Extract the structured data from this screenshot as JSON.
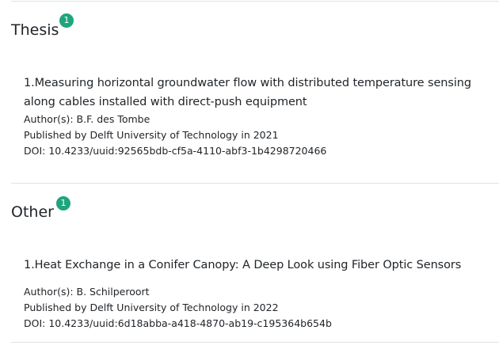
{
  "colors": {
    "badge": "#1fa57e",
    "divider": "#dee2e6",
    "text": "#212529"
  },
  "sections": [
    {
      "title": "Thesis",
      "count": "1",
      "items": [
        {
          "title": "1.Measuring horizontal groundwater flow with distributed temperature sensing along cables installed with direct-push equipment",
          "authors": "Author(s): B.F. des Tombe",
          "published": "Published by Delft University of Technology in 2021",
          "doi": "DOI: 10.4233/uuid:92565bdb-cf5a-4110-abf3-1b4298720466"
        }
      ]
    },
    {
      "title": "Other",
      "count": "1",
      "items": [
        {
          "title": "1.Heat Exchange in a Conifer Canopy: A Deep Look using Fiber Optic Sensors",
          "authors": "Author(s): B. Schilperoort",
          "published": "Published by Delft University of Technology in 2022",
          "doi": "DOI: 10.4233/uuid:6d18abba-a418-4870-ab19-c195364b654b"
        }
      ]
    }
  ]
}
